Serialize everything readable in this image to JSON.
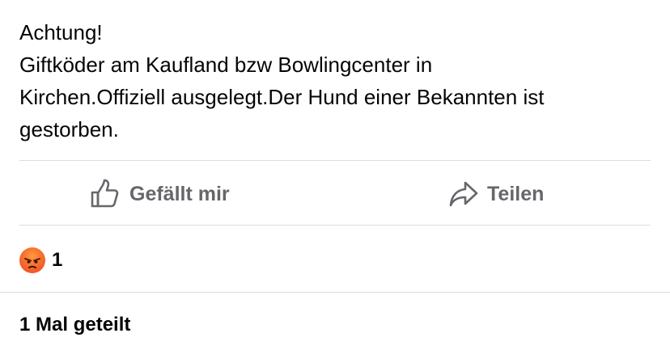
{
  "post": {
    "lines": [
      "Achtung!",
      "Giftköder am Kaufland bzw Bowlingcenter in",
      "Kirchen.Offiziell ausgelegt.Der Hund einer Bekannten ist",
      "gestorben."
    ]
  },
  "actions": {
    "like_label": "Gefällt mir",
    "like_icon": "thumbs-up-icon",
    "share_label": "Teilen",
    "share_icon": "share-arrow-icon"
  },
  "reactions": {
    "icon": "angry-reaction-icon",
    "count": "1"
  },
  "shares": {
    "label": "1 Mal geteilt"
  },
  "colors": {
    "text": "#050505",
    "secondary": "#65676b",
    "divider": "#dadde1",
    "angry": "#f5612a"
  }
}
